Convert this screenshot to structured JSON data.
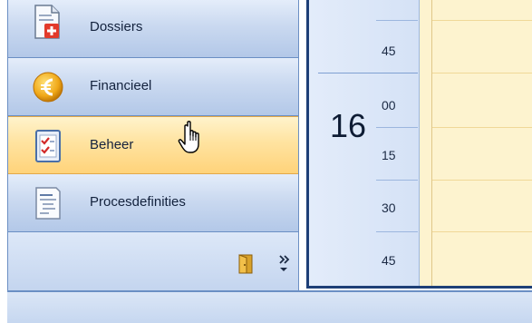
{
  "nav": {
    "items": [
      {
        "label": "Dossiers",
        "icon": "document-add-icon"
      },
      {
        "label": "Financieel",
        "icon": "euro-coin-icon"
      },
      {
        "label": "Beheer",
        "icon": "checklist-icon",
        "state": "hover"
      },
      {
        "label": "Procesdefinities",
        "icon": "list-document-icon"
      }
    ],
    "footer": {
      "exit_icon": "door-exit-icon",
      "overflow_icon": "chevron-double-down-icon"
    }
  },
  "calendar": {
    "hour": "16",
    "slots": [
      "45",
      "00",
      "15",
      "30",
      "45"
    ]
  },
  "cursor": {
    "icon": "hand-pointer-icon"
  },
  "colors": {
    "nav_blue": "#cad9f0",
    "hover_orange": "#ffd37a",
    "calendar_border": "#1e3f77",
    "calendar_bg": "#fdf3cf"
  }
}
